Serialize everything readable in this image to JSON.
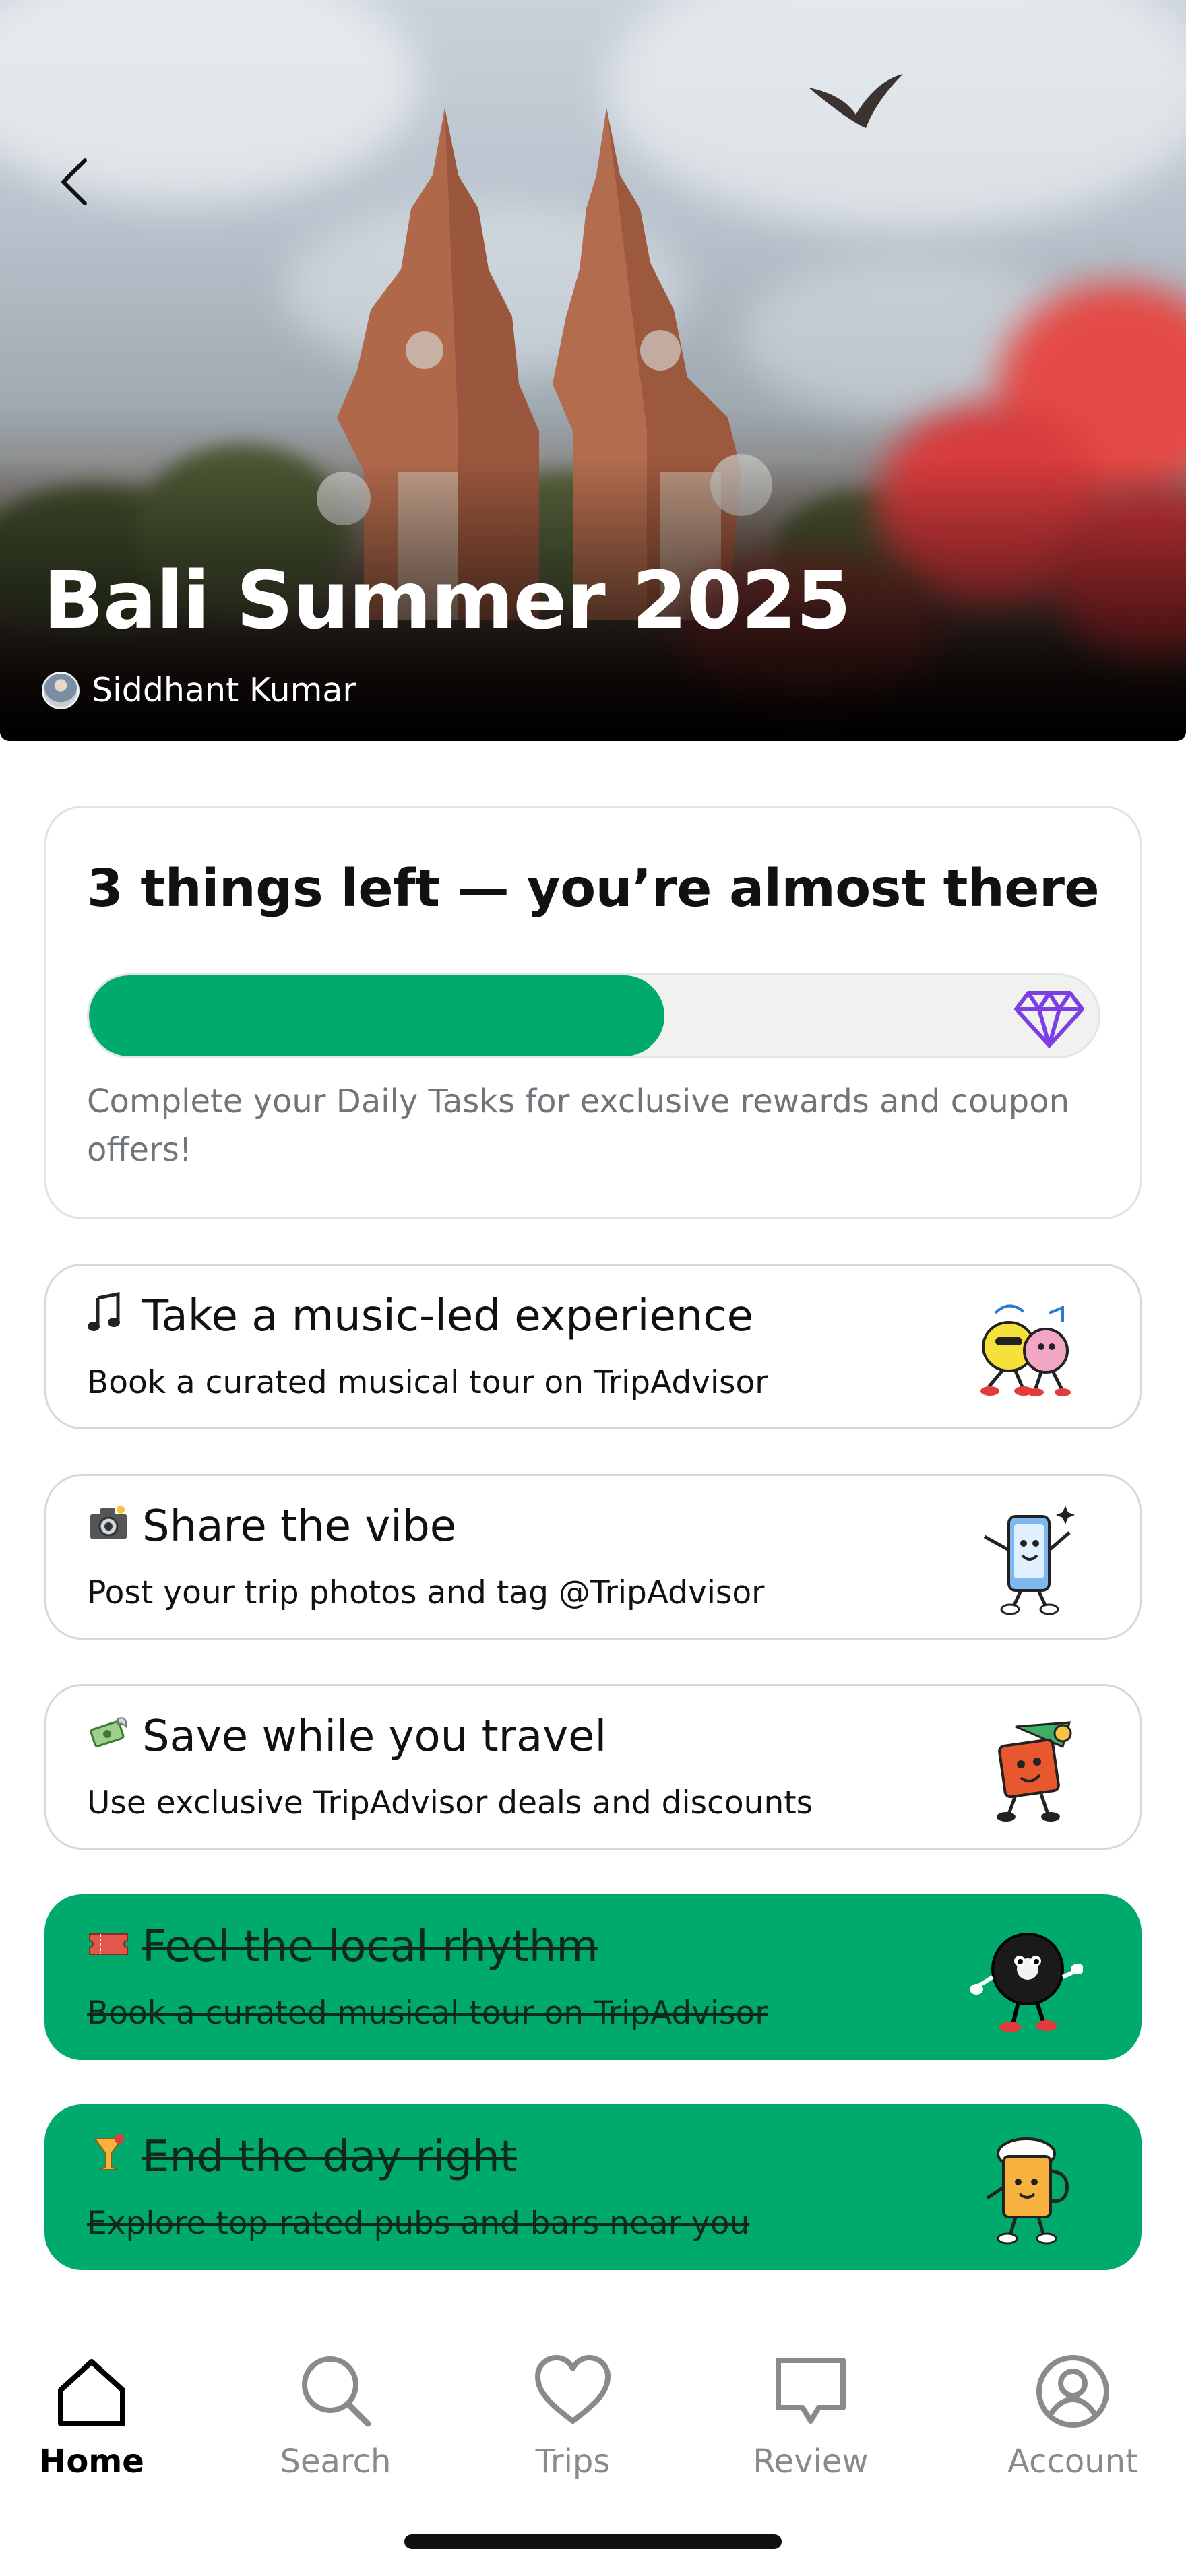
{
  "hero": {
    "title": "Bali Summer 2025",
    "author": "Siddhant Kumar",
    "back_icon": "chevron-left-icon"
  },
  "progress": {
    "title": "3 things left — you’re almost there",
    "description": "Complete your Daily Tasks for exclusive rewards and coupon offers!",
    "completed_fraction": 0.57,
    "reward_icon": "diamond-icon",
    "fill_color": "#00aa6c",
    "reward_color": "#7b3fe4"
  },
  "tasks": [
    {
      "emoji": "music-notes-icon",
      "title": "Take a music-led experience",
      "subtitle": "Book a curated musical tour on TripAdvisor",
      "done": false,
      "art": "dancing-character-illustration"
    },
    {
      "emoji": "camera-icon",
      "title": "Share the vibe",
      "subtitle": "Post your trip photos and tag @TripAdvisor",
      "done": false,
      "art": "phone-character-illustration"
    },
    {
      "emoji": "money-wings-icon",
      "title": "Save while you travel",
      "subtitle": "Use exclusive TripAdvisor deals and discounts",
      "done": false,
      "art": "wallet-character-illustration"
    },
    {
      "emoji": "ticket-icon",
      "title": "Feel the local rhythm",
      "subtitle": "Book a curated musical tour on TripAdvisor",
      "done": true,
      "art": "vinyl-character-illustration"
    },
    {
      "emoji": "cocktail-icon",
      "title": "End the day right",
      "subtitle": "Explore top-rated pubs and bars near you",
      "done": true,
      "art": "beer-character-illustration"
    }
  ],
  "nav": {
    "active": "Home",
    "items": [
      {
        "label": "Home",
        "icon": "home-icon"
      },
      {
        "label": "Search",
        "icon": "search-icon"
      },
      {
        "label": "Trips",
        "icon": "heart-icon"
      },
      {
        "label": "Review",
        "icon": "chat-bubble-icon"
      },
      {
        "label": "Account",
        "icon": "account-icon"
      }
    ]
  },
  "colors": {
    "accent_green": "#00aa6c",
    "card_border": "#e2e2e2",
    "muted_text": "#70757a"
  }
}
